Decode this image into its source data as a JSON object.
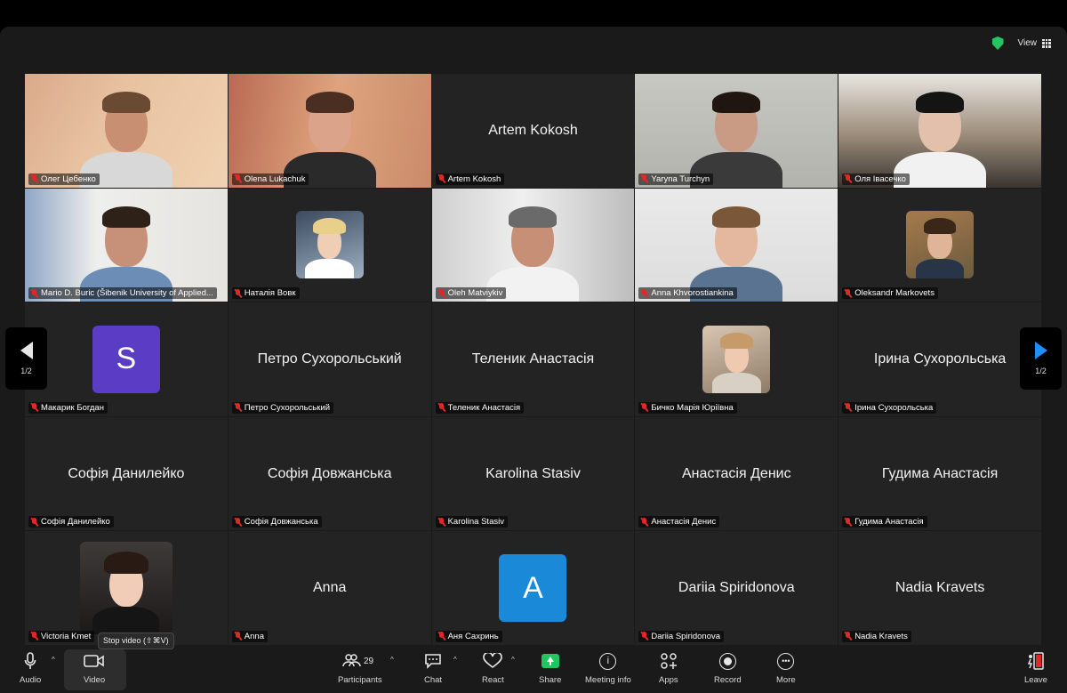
{
  "topbar": {
    "view_label": "View"
  },
  "page_indicator": "1/2",
  "tiles": [
    {
      "name": "Олег Цебенко",
      "kind": "video",
      "scene": "warm"
    },
    {
      "name": "Olena Lukachuk",
      "kind": "video",
      "scene": "warm2"
    },
    {
      "name": "Artem Kokosh",
      "big": "Artem Kokosh",
      "kind": "text"
    },
    {
      "name": "Yaryna Turchyn",
      "kind": "video",
      "scene": "grey"
    },
    {
      "name": "Оля Івасечко",
      "kind": "video",
      "scene": "stairs"
    },
    {
      "name": "Mario D. Buric (Šibenik University of Applied...",
      "kind": "video",
      "scene": "office"
    },
    {
      "name": "Наталія Вовк",
      "kind": "photo"
    },
    {
      "name": "Oleh Matviykiv",
      "kind": "video",
      "scene": "window"
    },
    {
      "name": "Anna Khvorostiankina",
      "kind": "video",
      "scene": "light",
      "active": true
    },
    {
      "name": "Oleksandr Markovets",
      "kind": "photo2"
    },
    {
      "name": "Макарик Богдан",
      "kind": "avatar",
      "letter": "S",
      "color": "#5b3cc4"
    },
    {
      "name": "Петро Сухорольський",
      "big": "Петро Сухорольський",
      "kind": "text"
    },
    {
      "name": "Теленик Анастасія",
      "big": "Теленик Анастасія",
      "kind": "text"
    },
    {
      "name": "Бичко Марія Юріївна",
      "kind": "photo3"
    },
    {
      "name": "Ірина Сухорольська",
      "big": "Ірина Сухорольська",
      "kind": "text"
    },
    {
      "name": "Софія Данилейко",
      "big": "Софія Данилейко",
      "kind": "text"
    },
    {
      "name": "Софія Довжанська",
      "big": "Софія Довжанська",
      "kind": "text"
    },
    {
      "name": "Karolina Stasiv",
      "big": "Karolina Stasiv",
      "kind": "text"
    },
    {
      "name": "Анастасія Денис",
      "big": "Анастасія Денис",
      "kind": "text"
    },
    {
      "name": "Гудима Анастасія",
      "big": "Гудима Анастасія",
      "kind": "text"
    },
    {
      "name": "Victoria Kmet",
      "kind": "photo4"
    },
    {
      "name": "Anna",
      "big": "Anna",
      "kind": "text"
    },
    {
      "name": "Аня Сахринь",
      "kind": "avatar",
      "letter": "A",
      "color": "#1a8ad8"
    },
    {
      "name": "Dariia Spiridonova",
      "big": "Dariia Spiridonova",
      "kind": "text"
    },
    {
      "name": "Nadia Kravets",
      "big": "Nadia Kravets",
      "kind": "text"
    }
  ],
  "toolbar": {
    "audio": "Audio",
    "video": "Video",
    "tooltip": "Stop video (⇧⌘V)",
    "participants": "Participants",
    "participants_count": "29",
    "chat": "Chat",
    "react": "React",
    "share": "Share",
    "meeting_info": "Meeting info",
    "apps": "Apps",
    "record": "Record",
    "more": "More",
    "leave": "Leave"
  },
  "colors": {
    "accent_green": "#23c552",
    "mute_red": "#e02828",
    "nav_blue": "#1f8fff"
  }
}
